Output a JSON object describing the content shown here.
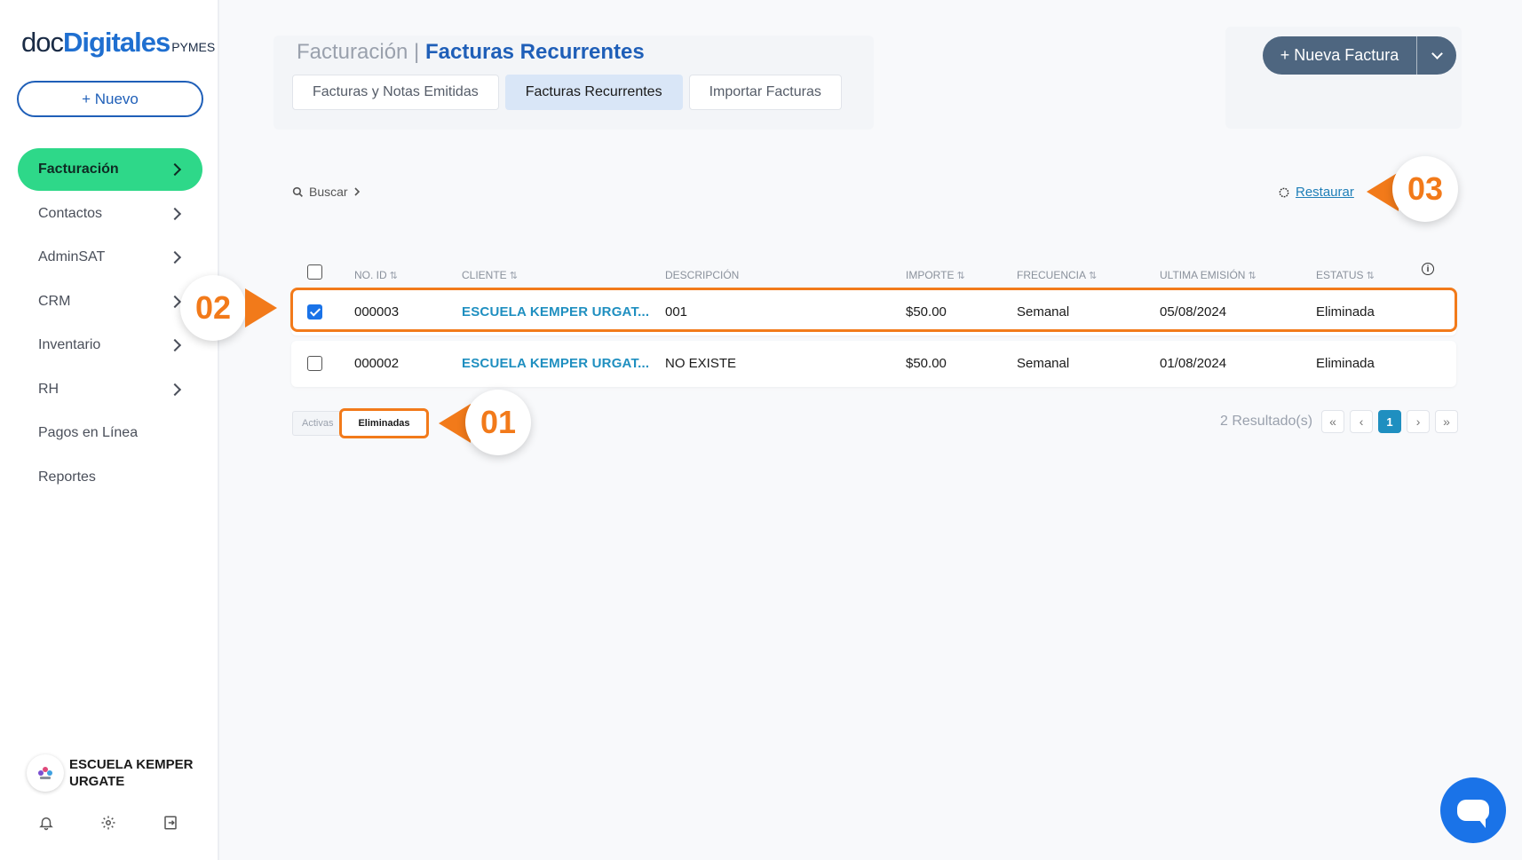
{
  "sidebar": {
    "logo": {
      "doc": "doc",
      "digitales": "Digitales",
      "pymes": "PYMES"
    },
    "new_button": "+ Nuevo",
    "items": [
      {
        "label": "Facturación",
        "active": true,
        "has_chevron": true
      },
      {
        "label": "Contactos",
        "has_chevron": true
      },
      {
        "label": "AdminSAT",
        "has_chevron": true
      },
      {
        "label": "CRM",
        "has_chevron": true
      },
      {
        "label": "Inventario",
        "has_chevron": true
      },
      {
        "label": "RH",
        "has_chevron": true
      },
      {
        "label": "Pagos en Línea",
        "has_chevron": false
      },
      {
        "label": "Reportes",
        "has_chevron": false
      }
    ],
    "company_name": "ESCUELA KEMPER URGATE",
    "bottom_icons": [
      "bell-icon",
      "gear-icon",
      "logout-icon"
    ]
  },
  "header": {
    "title_section": "Facturación",
    "title_separator": " | ",
    "title_page": "Facturas Recurrentes",
    "tabs": [
      {
        "label": "Facturas y Notas Emitidas",
        "active": false
      },
      {
        "label": "Facturas Recurrentes",
        "active": true
      },
      {
        "label": "Importar Facturas",
        "active": false
      }
    ],
    "new_invoice_button": "+ Nueva Factura"
  },
  "toolbar": {
    "search_label": "Buscar",
    "restore_label": "Restaurar"
  },
  "table": {
    "columns": [
      "NO. ID",
      "CLIENTE",
      "DESCRIPCIÓN",
      "IMPORTE",
      "FRECUENCIA",
      "ULTIMA EMISIÓN",
      "ESTATUS"
    ],
    "rows": [
      {
        "checked": true,
        "id": "000003",
        "cliente": "ESCUELA KEMPER URGAT...",
        "descripcion": "001",
        "importe": "$50.00",
        "frecuencia": "Semanal",
        "ultima_emision": "05/08/2024",
        "estatus": "Eliminada"
      },
      {
        "checked": false,
        "id": "000002",
        "cliente": "ESCUELA KEMPER URGAT...",
        "descripcion": "NO EXISTE",
        "importe": "$50.00",
        "frecuencia": "Semanal",
        "ultima_emision": "01/08/2024",
        "estatus": "Eliminada"
      }
    ]
  },
  "footer": {
    "status_tabs": {
      "activas": "Activas",
      "eliminadas": "Eliminadas"
    },
    "results": "2 Resultado(s)",
    "current_page": "1"
  },
  "callouts": {
    "one": "01",
    "two": "02",
    "three": "03"
  },
  "colors": {
    "accent_green": "#2ed889",
    "brand_blue": "#1f5fb8",
    "callout_orange": "#f27a1a",
    "link_blue": "#1f8fc0"
  }
}
